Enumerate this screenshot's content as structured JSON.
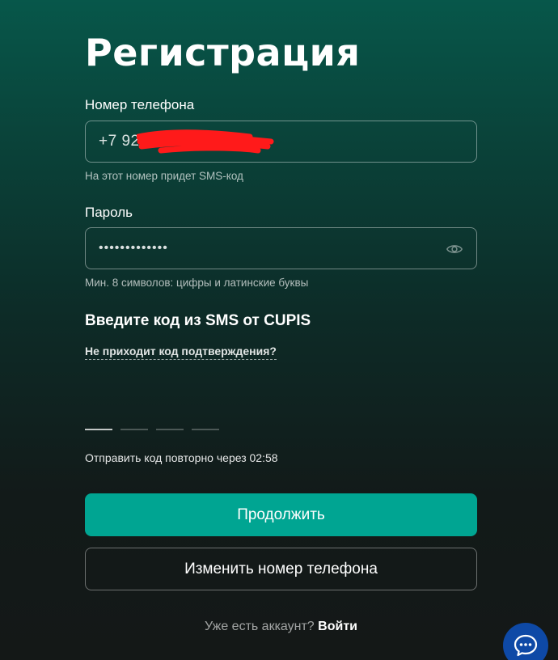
{
  "form": {
    "title": "Регистрация",
    "phone": {
      "label": "Номер телефона",
      "value": "+7 925",
      "hint": "На этот номер придет SMS-код"
    },
    "password": {
      "label": "Пароль",
      "value": "•••••••••••••",
      "hint": "Мин. 8 символов: цифры и латинские буквы",
      "toggle_icon": "eye-icon"
    },
    "sms": {
      "heading": "Введите код из SMS от CUPIS",
      "no_code_link": "Не приходит код подтверждения?",
      "resend_text": "Отправить код повторно через 02:58"
    },
    "continue_label": "Продолжить",
    "change_phone_label": "Изменить номер телефона",
    "login_prompt": "Уже есть аккаунт?",
    "login_link": "Войти"
  },
  "chat": {
    "icon": "chat-bubble-icon"
  },
  "colors": {
    "accent": "#00a592",
    "chat_button": "#0e49a6"
  }
}
